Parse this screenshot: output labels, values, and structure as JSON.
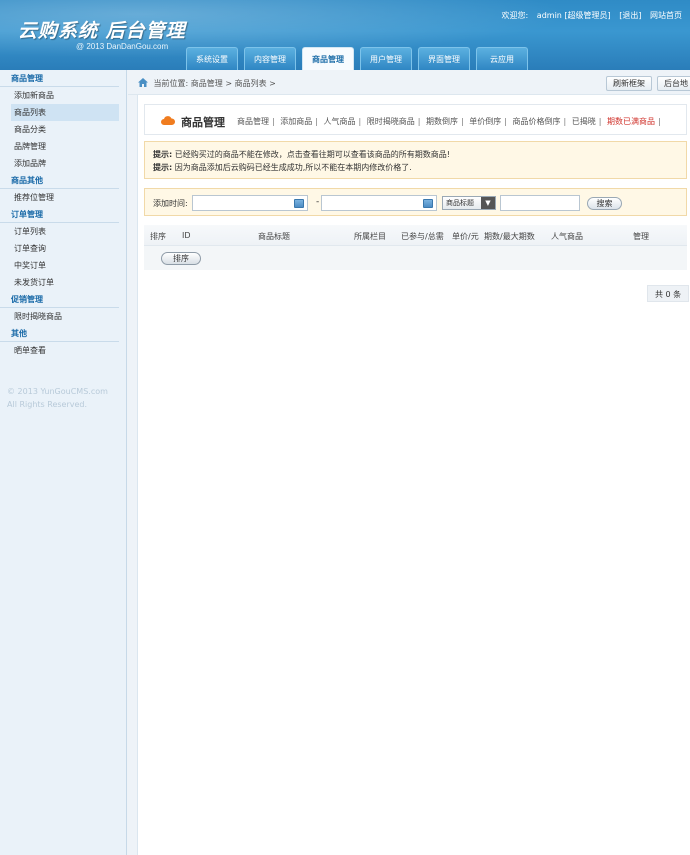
{
  "header": {
    "logo_title": "云购系统 后台管理",
    "logo_sub": "@ 2013  DanDanGou.com",
    "welcome": "欢迎您:",
    "user": "admin [超级管理员]",
    "logout": "[退出]",
    "site_home": "网站首页"
  },
  "nav": {
    "tabs": [
      "系统设置",
      "内容管理",
      "商品管理",
      "用户管理",
      "界面管理",
      "云应用"
    ],
    "active": "商品管理"
  },
  "sidebar": {
    "groups": [
      {
        "title": "商品管理",
        "items": [
          "添加新商品",
          "商品列表",
          "商品分类",
          "品牌管理",
          "添加品牌"
        ]
      },
      {
        "title": "商品其他",
        "items": [
          "推荐位管理"
        ]
      },
      {
        "title": "订单管理",
        "items": [
          "订单列表",
          "订单查询",
          "中奖订单",
          "未发货订单"
        ]
      },
      {
        "title": "促销管理",
        "items": [
          "限时揭晓商品"
        ]
      },
      {
        "title": "其他",
        "items": [
          "晒单查看"
        ]
      }
    ],
    "active_item": "商品列表",
    "copyright_1": "© 2013 YunGouCMS.com",
    "copyright_2": "All Rights Reserved."
  },
  "breadcrumb": "当前位置: 商品管理 > 商品列表 >",
  "top_buttons": {
    "refresh": "刷新框架",
    "backend": "后台地"
  },
  "title_bar": {
    "title": "商品管理",
    "links": [
      "商品管理",
      "添加商品",
      "人气商品",
      "限时揭晓商品",
      "期数倒序",
      "单价倒序",
      "商品价格倒序",
      "已揭晓",
      "期数已满商品"
    ]
  },
  "tips": {
    "label": "提示:",
    "line1": "已经购买过的商品不能在修改，点击查看往期可以查看该商品的所有期数商品!",
    "line2": "因为商品添加后云购码已经生成成功,所以不能在本期内修改价格了."
  },
  "search": {
    "label": "添加时间:",
    "dash": "-",
    "select_value": "商品标题",
    "button": "搜索"
  },
  "table": {
    "headers": [
      "排序",
      "ID",
      "商品标题",
      "所属栏目",
      "已参与/总需",
      "单价/元",
      "期数/最大期数",
      "人气商品",
      "管理"
    ],
    "sort_button": "排序"
  },
  "total": "共 0 条"
}
